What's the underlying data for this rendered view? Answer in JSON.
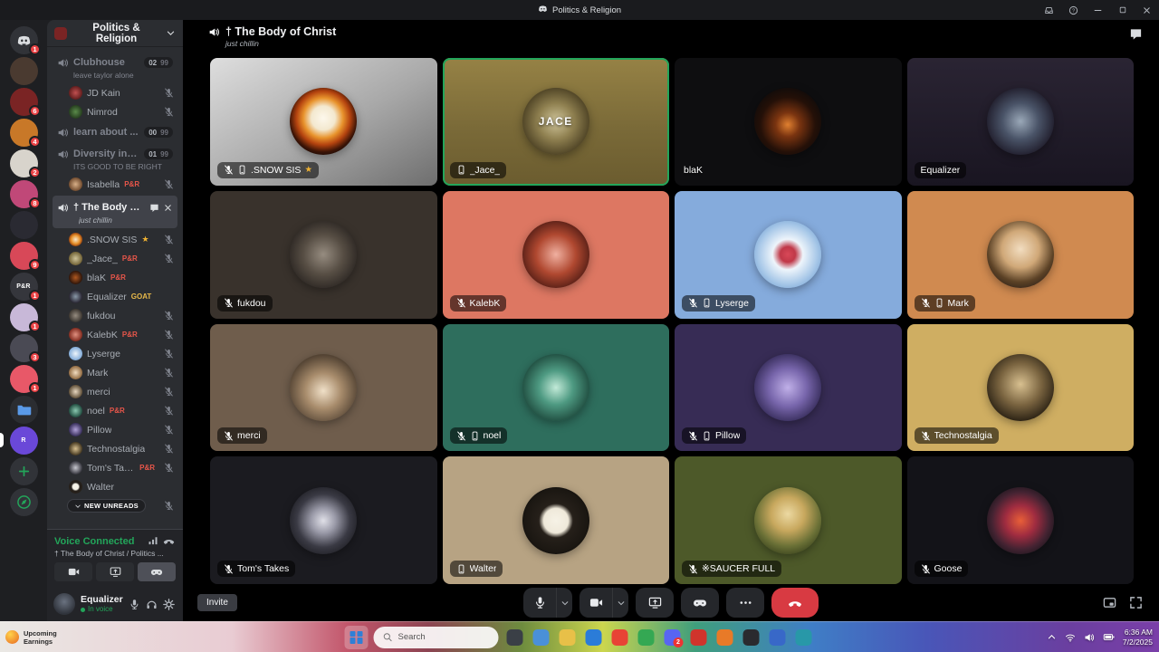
{
  "colors": {
    "accent_green": "#23a55a",
    "danger_red": "#d83a42",
    "notification_badge_red": "#eb4245",
    "star_yellow": "#f0b232",
    "role_badge_red": "#e8564a",
    "role_badge_gold": "#e8b94a",
    "sidebar_bg": "#2b2d31",
    "app_bg": "#1e1f22",
    "voice_bg": "#000000"
  },
  "titlebar": {
    "title": "Politics & Religion"
  },
  "server_rail": {
    "items": [
      {
        "name": "discord-home",
        "color": "#313338",
        "icon": "discord",
        "icon_color": "#dbdee1",
        "badge": "1"
      },
      {
        "name": "server-1",
        "color": "#4a3a30"
      },
      {
        "name": "server-2",
        "color": "#7a2424",
        "badge": "6"
      },
      {
        "name": "server-3",
        "color": "#c87828",
        "badge": "4"
      },
      {
        "name": "server-4",
        "color": "#d8d4cc",
        "badge": "2"
      },
      {
        "name": "server-5",
        "color": "#c04878",
        "badge": "8"
      },
      {
        "name": "server-6",
        "color": "#2a2a32"
      },
      {
        "name": "server-7",
        "color": "#d84858",
        "badge": "9"
      },
      {
        "name": "server-pr",
        "color": "#35363c",
        "label": "P&R",
        "badge": "1"
      },
      {
        "name": "server-8",
        "color": "#c8b8d8",
        "badge": "1"
      },
      {
        "name": "server-9",
        "color": "#4a4a54",
        "badge": "3"
      },
      {
        "name": "server-10",
        "color": "#e85868",
        "badge": "1"
      },
      {
        "name": "server-folder",
        "color": "#2b2d31",
        "icon": "folder",
        "icon_color": "#5a9ae8"
      },
      {
        "name": "rumble",
        "color": "#6a48d8",
        "label": "R",
        "active": true
      },
      {
        "name": "add-server",
        "color": "#313338",
        "icon": "plus",
        "icon_color": "#23a55a"
      },
      {
        "name": "explore",
        "color": "#313338",
        "icon": "compass",
        "icon_color": "#23a55a"
      }
    ]
  },
  "sidebar": {
    "server_name": "Politics & Religion",
    "new_unreads_label": "NEW UNREADS",
    "channels": [
      {
        "name": "Clubhouse",
        "count": "02",
        "cap": "99",
        "subtitle": "leave taylor alone",
        "users": [
          {
            "name": "JD Kain",
            "muted": true,
            "avatar": "radial-gradient(circle, #c05050 0%, #5a1a1a 75%)"
          },
          {
            "name": "Nimrod",
            "muted": true,
            "avatar": "radial-gradient(circle, #5a8a4a 0%, #22381c 75%)"
          }
        ]
      },
      {
        "name": "learn about ...",
        "count": "00",
        "cap": "99",
        "users": []
      },
      {
        "name": "Diversity in D...",
        "count": "01",
        "cap": "99",
        "subtitle": "ITS GOOD TO BE RIGHT",
        "users": [
          {
            "name": "Isabella",
            "badge": "P&R",
            "muted": true,
            "avatar": "radial-gradient(circle, #d8b088 0%, #6a4428 75%)"
          }
        ]
      },
      {
        "name": "† The Body of C...",
        "selected": true,
        "subtitle": "just chillin",
        "users": [
          {
            "name": ".SNOW SIS",
            "star": true,
            "muted": true,
            "avatar": "radial-gradient(circle, #f5e8cf 0%, #e8932c 45%, #7a2808 80%)"
          },
          {
            "name": "_Jace_",
            "badge": "P&R",
            "muted": true,
            "avatar": "radial-gradient(circle, #cfc49a 0%, #6b5c2f 75%)"
          },
          {
            "name": "blaK",
            "badge": "P&R",
            "avatar": "radial-gradient(circle, #b05820 0%, #241008 75%)"
          },
          {
            "name": "Equalizer",
            "badge": "GOAT",
            "badge_color": "#e8b94a",
            "avatar": "radial-gradient(circle, #8a98a8 0%, #201c28 75%)"
          },
          {
            "name": "fukdou",
            "muted": true,
            "avatar": "radial-gradient(circle, #968c80 0%, #35302a 75%)"
          },
          {
            "name": "KalebK",
            "badge": "P&R",
            "muted": true,
            "avatar": "radial-gradient(circle, #e09080 0%, #7a2418 75%)"
          },
          {
            "name": "Lyserge",
            "muted": true,
            "avatar": "radial-gradient(circle, #eef5fb 0%, #7aa6d6 75%)"
          },
          {
            "name": "Mark",
            "muted": true,
            "avatar": "radial-gradient(circle, #f2ddc0 0%, #8a6238 75%)"
          },
          {
            "name": "merci",
            "muted": true,
            "avatar": "radial-gradient(circle, #e8d8c0 0%, #54442e 75%)"
          },
          {
            "name": "noel",
            "badge": "P&R",
            "muted": true,
            "avatar": "radial-gradient(circle, #8ac8b0 0%, #1a4438 75%)"
          },
          {
            "name": "Pillow",
            "muted": true,
            "avatar": "radial-gradient(circle, #b0a0d8 0%, #2e2550 75%)"
          },
          {
            "name": "Technostalgia",
            "muted": true,
            "avatar": "radial-gradient(circle, #d8c090 0%, #3a2e18 75%)"
          },
          {
            "name": "Tom's Takes",
            "badge": "P&R",
            "muted": true,
            "avatar": "radial-gradient(circle, #c8c8d0 0%, #2a2a32 75%)"
          },
          {
            "name": "Walter",
            "avatar": "radial-gradient(circle, #f6f2e6 30%, #26201a 45%)"
          }
        ]
      }
    ]
  },
  "voice_panel": {
    "status": "Voice Connected",
    "location": "† The Body of Christ / Politics ..."
  },
  "user_panel": {
    "username": "Equalizer",
    "status": "In voice"
  },
  "main": {
    "header": {
      "title": "† The Body of Christ",
      "subtitle": "just chillin"
    },
    "invite_label": "Invite",
    "tiles": [
      {
        "name": ".SNOW SIS",
        "muted": true,
        "mobile": true,
        "star": true,
        "bg": "linear-gradient(150deg,#dedede 0%,#a8a8a8 55%,#6e6e6e 100%)",
        "avatar": "radial-gradient(circle at 50% 45%, #fdf8ec 0%, #f3e8cf 24%, #e8932c 40%, #b4430f 54%, #3c1406 68%, #120805 80%)"
      },
      {
        "name": "_Jace_",
        "mobile": true,
        "speaking": true,
        "label": "JACE",
        "bg": "linear-gradient(180deg,#968245 0%,#7a6a38 55%,#6b5c2f 100%)",
        "avatar": "radial-gradient(circle, #cfc49a 0%, #8f8050 38%, #4a3f22 75%)"
      },
      {
        "name": "blaK",
        "tagless": true,
        "bg": "#0e0e10",
        "avatar": "radial-gradient(circle at 50% 55%, #e08030 0%, #7a3410 24%, #241008 55%, #0c0a0a 82%)"
      },
      {
        "name": "Equalizer",
        "bg": "linear-gradient(180deg,#2a2433 0%,#191521 100%)",
        "avatar": "radial-gradient(circle, #9aa8b8 0%, #4a5468 38%, #1c1826 78%)"
      },
      {
        "name": "fukdou",
        "muted": true,
        "bg": "#39322c",
        "avatar": "radial-gradient(circle, #968c80 0%, #574e44 42%, #282320 80%)"
      },
      {
        "name": "KalebK",
        "muted": true,
        "bg": "#dd7762",
        "avatar": "radial-gradient(circle, #f0b0a0 0%, #b04830 42%, #481812 80%)"
      },
      {
        "name": "Lyserge",
        "muted": true,
        "mobile": true,
        "bg": "#85abdc",
        "avatar": "radial-gradient(circle, #d84858 0%, #c03848 16%, #eef5fb 32%, #a8c8e8 62%, #7aa6d6 82%)"
      },
      {
        "name": "Mark",
        "muted": true,
        "mobile": true,
        "bg": "#d08a50",
        "avatar": "radial-gradient(circle at 50% 42%, #f2ddc0 0%, #d0a878 36%, #5c4226 64%, #33241a 82%)"
      },
      {
        "name": "merci",
        "muted": true,
        "bg": "#6f5d4c",
        "avatar": "radial-gradient(circle at 50% 55%, #f0e0c8 0%, #a88c6c 36%, #544434 72%)"
      },
      {
        "name": "noel",
        "muted": true,
        "mobile": true,
        "bg": "#2e6e5d",
        "avatar": "radial-gradient(circle, #c2ead8 0%, #4e9a82 36%, #1a4438 78%)"
      },
      {
        "name": "Pillow",
        "muted": true,
        "mobile": true,
        "bg": "#372c55",
        "avatar": "radial-gradient(circle, #c0b0e8 0%, #7866ac 40%, #2e2550 80%)"
      },
      {
        "name": "Technostalgia",
        "muted": true,
        "bg": "#cfae62",
        "avatar": "radial-gradient(circle at 50% 45%, #d8c090 0%, #7a6440 42%, #241c10 78%)"
      },
      {
        "name": "Tom's Takes",
        "muted": true,
        "bg": "#1b1b20",
        "avatar": "radial-gradient(circle, #e0e0e8 0%, #9a9aa8 26%, #3a3a44 56%, #1b1b20 82%)"
      },
      {
        "name": "Walter",
        "mobile": true,
        "bg": "#b7a383",
        "avatar": "radial-gradient(circle, #f6f2e6 0%, #efe9da 26%, #26201a 36%, #1b1712 66%, #0e0c0a 80%)"
      },
      {
        "name": "※SAUCER FULL",
        "muted": true,
        "bg": "#4d5929",
        "avatar": "radial-gradient(circle at 50% 40%, #ecd9a2 0%, #c8a85e 32%, #6a7036 62%, #3c451e 82%)"
      },
      {
        "name": "Goose",
        "muted": true,
        "bg": "#131318",
        "avatar": "radial-gradient(circle, #e85f38 0%, #a02c40 32%, #452332 60%, #16141a 82%)"
      }
    ]
  },
  "taskbar": {
    "widget_line1": "Upcoming",
    "widget_line2": "Earnings",
    "search_placeholder": "Search",
    "time": "6:36 AM",
    "date": "7/2/2025",
    "apps": [
      {
        "id": "task-view",
        "color": "#3a3f46"
      },
      {
        "id": "widgets",
        "color": "#4a90d8"
      },
      {
        "id": "file-explorer",
        "color": "#e8c048"
      },
      {
        "id": "edge",
        "color": "#2b7cd8"
      },
      {
        "id": "chrome",
        "color": "#e84335"
      },
      {
        "id": "app-green",
        "color": "#34a853"
      },
      {
        "id": "discord",
        "color": "#5865f2",
        "badge": "2"
      },
      {
        "id": "app-red",
        "color": "#d0342c"
      },
      {
        "id": "app-orange",
        "color": "#e87a28"
      },
      {
        "id": "obs",
        "color": "#2a2a2e"
      },
      {
        "id": "app-blue",
        "color": "#3868c8"
      },
      {
        "id": "app-teal",
        "color": "#2898a8"
      }
    ]
  }
}
